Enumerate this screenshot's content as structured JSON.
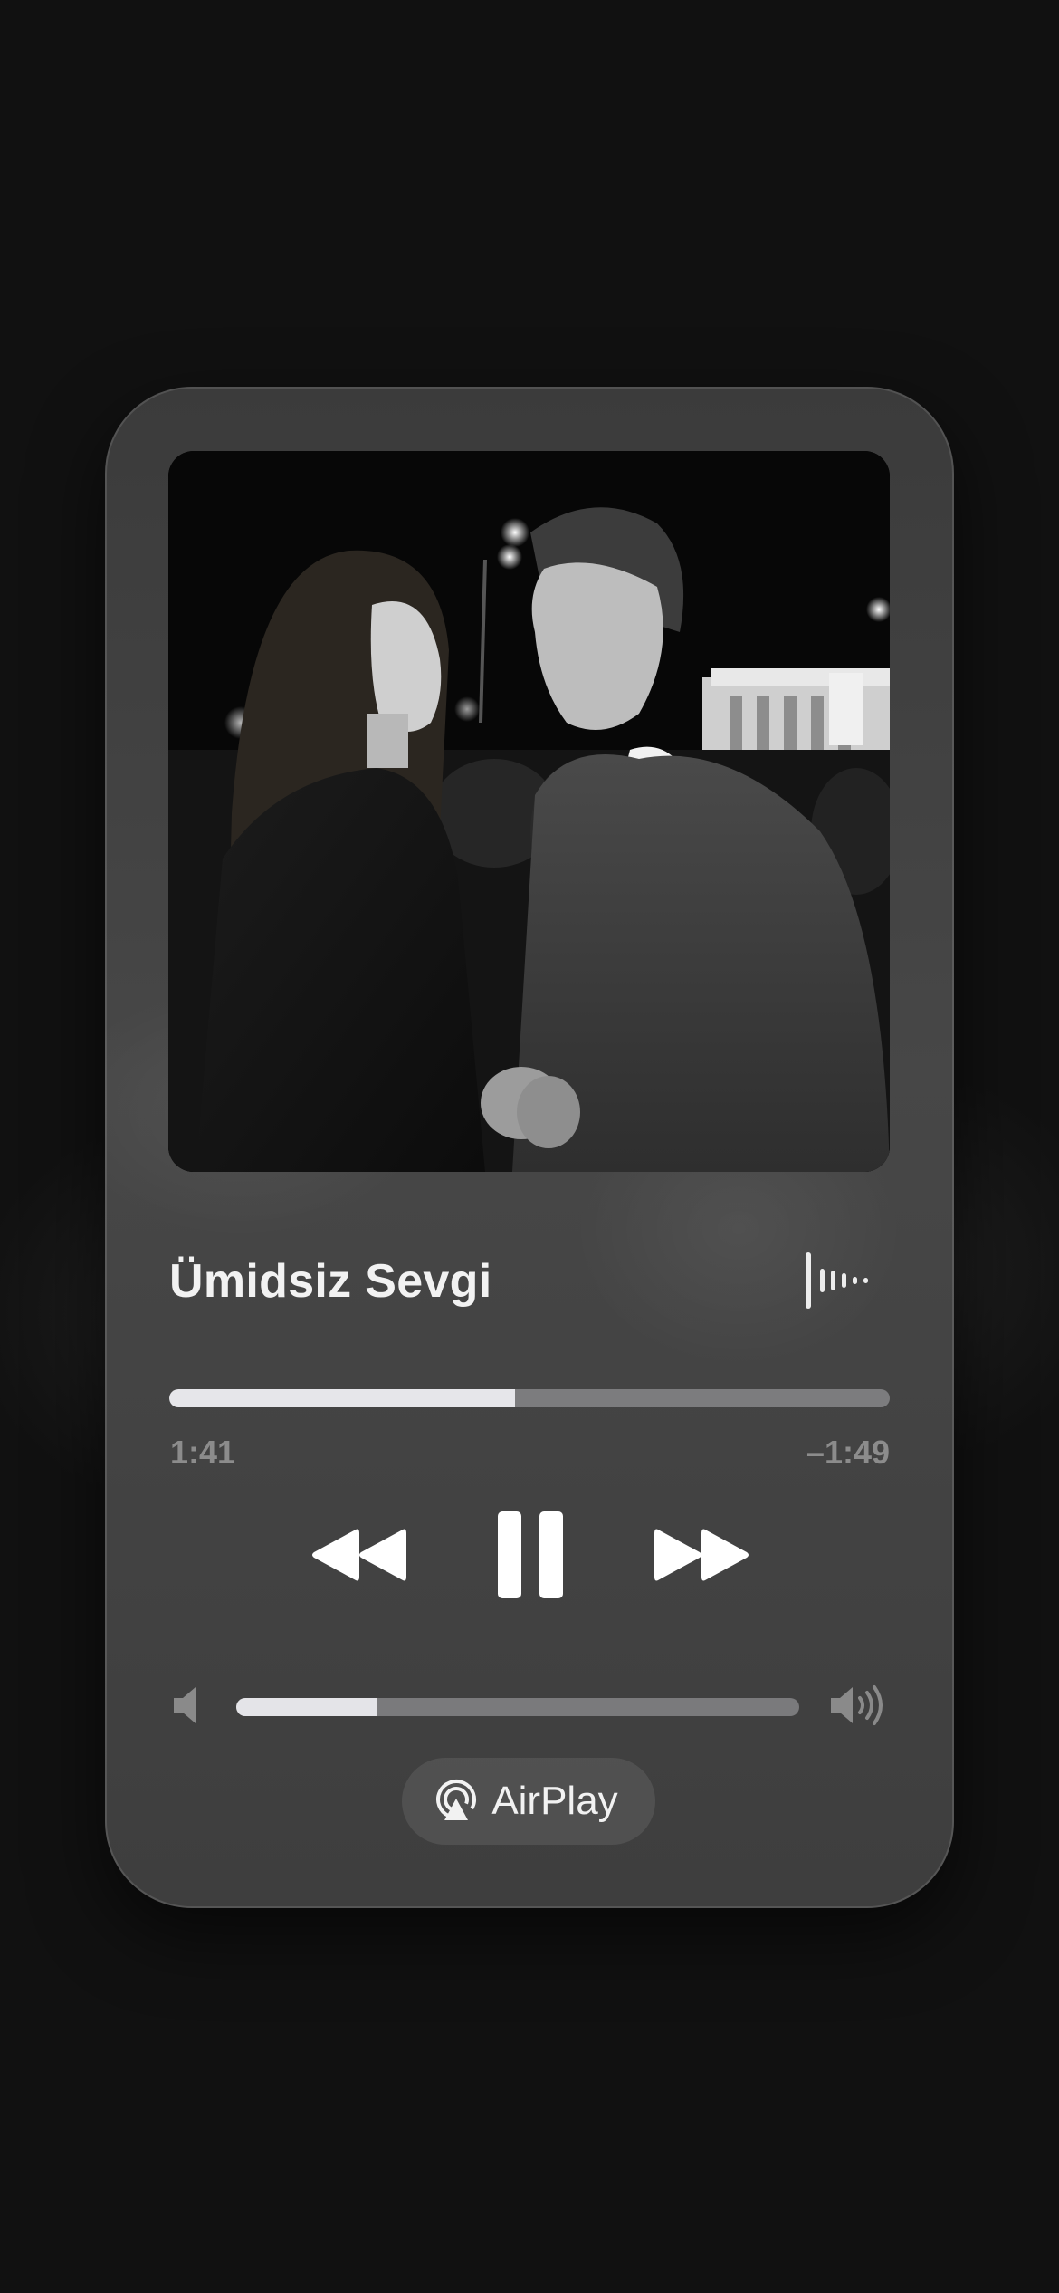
{
  "now_playing": {
    "title": "Ümidsiz Sevgi",
    "elapsed": "1:41",
    "remaining": "–1:49",
    "progress_fraction": 0.48
  },
  "controls": {
    "rewind_icon": "backward-icon",
    "pause_icon": "pause-icon",
    "forward_icon": "forward-icon",
    "waveform_icon": "waveform-icon"
  },
  "volume": {
    "level_fraction": 0.25,
    "low_icon": "speaker-low-icon",
    "high_icon": "speaker-high-icon"
  },
  "airplay": {
    "label": "AirPlay",
    "icon": "airplay-icon"
  },
  "colors": {
    "background": "#111111",
    "card": "#444444",
    "accent_fill": "#e6e6ea",
    "track": "#7c7c7e",
    "time_text": "#8c8c8c"
  }
}
